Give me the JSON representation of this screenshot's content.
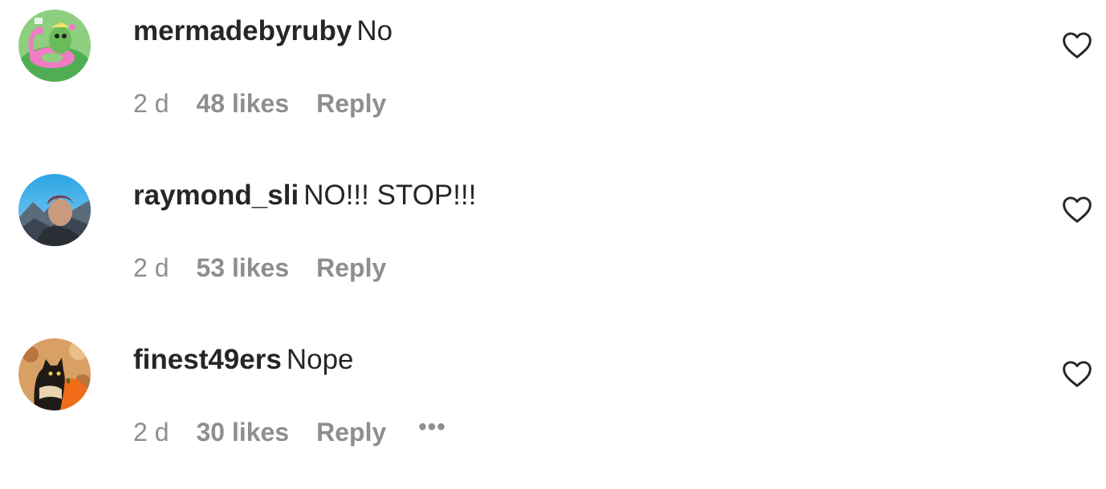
{
  "comments": [
    {
      "username": "mermadebyruby",
      "text": "No",
      "time": "2 d",
      "likes": "48 likes",
      "reply_label": "Reply",
      "avatar_icon": "flamingo-float-avatar",
      "like_icon": "heart-outline-icon",
      "show_more": false
    },
    {
      "username": "raymond_sli",
      "text": "NO!!! STOP!!!",
      "time": "2 d",
      "likes": "53 likes",
      "reply_label": "Reply",
      "avatar_icon": "mountain-selfie-avatar",
      "like_icon": "heart-outline-icon",
      "show_more": false
    },
    {
      "username": "finest49ers",
      "text": "Nope",
      "time": "2 d",
      "likes": "30 likes",
      "reply_label": "Reply",
      "avatar_icon": "cat-pumpkin-avatar",
      "like_icon": "heart-outline-icon",
      "show_more": true,
      "more_label": "•••"
    }
  ],
  "colors": {
    "text_primary": "#262626",
    "text_secondary": "#8e8e8e",
    "background": "#ffffff"
  }
}
